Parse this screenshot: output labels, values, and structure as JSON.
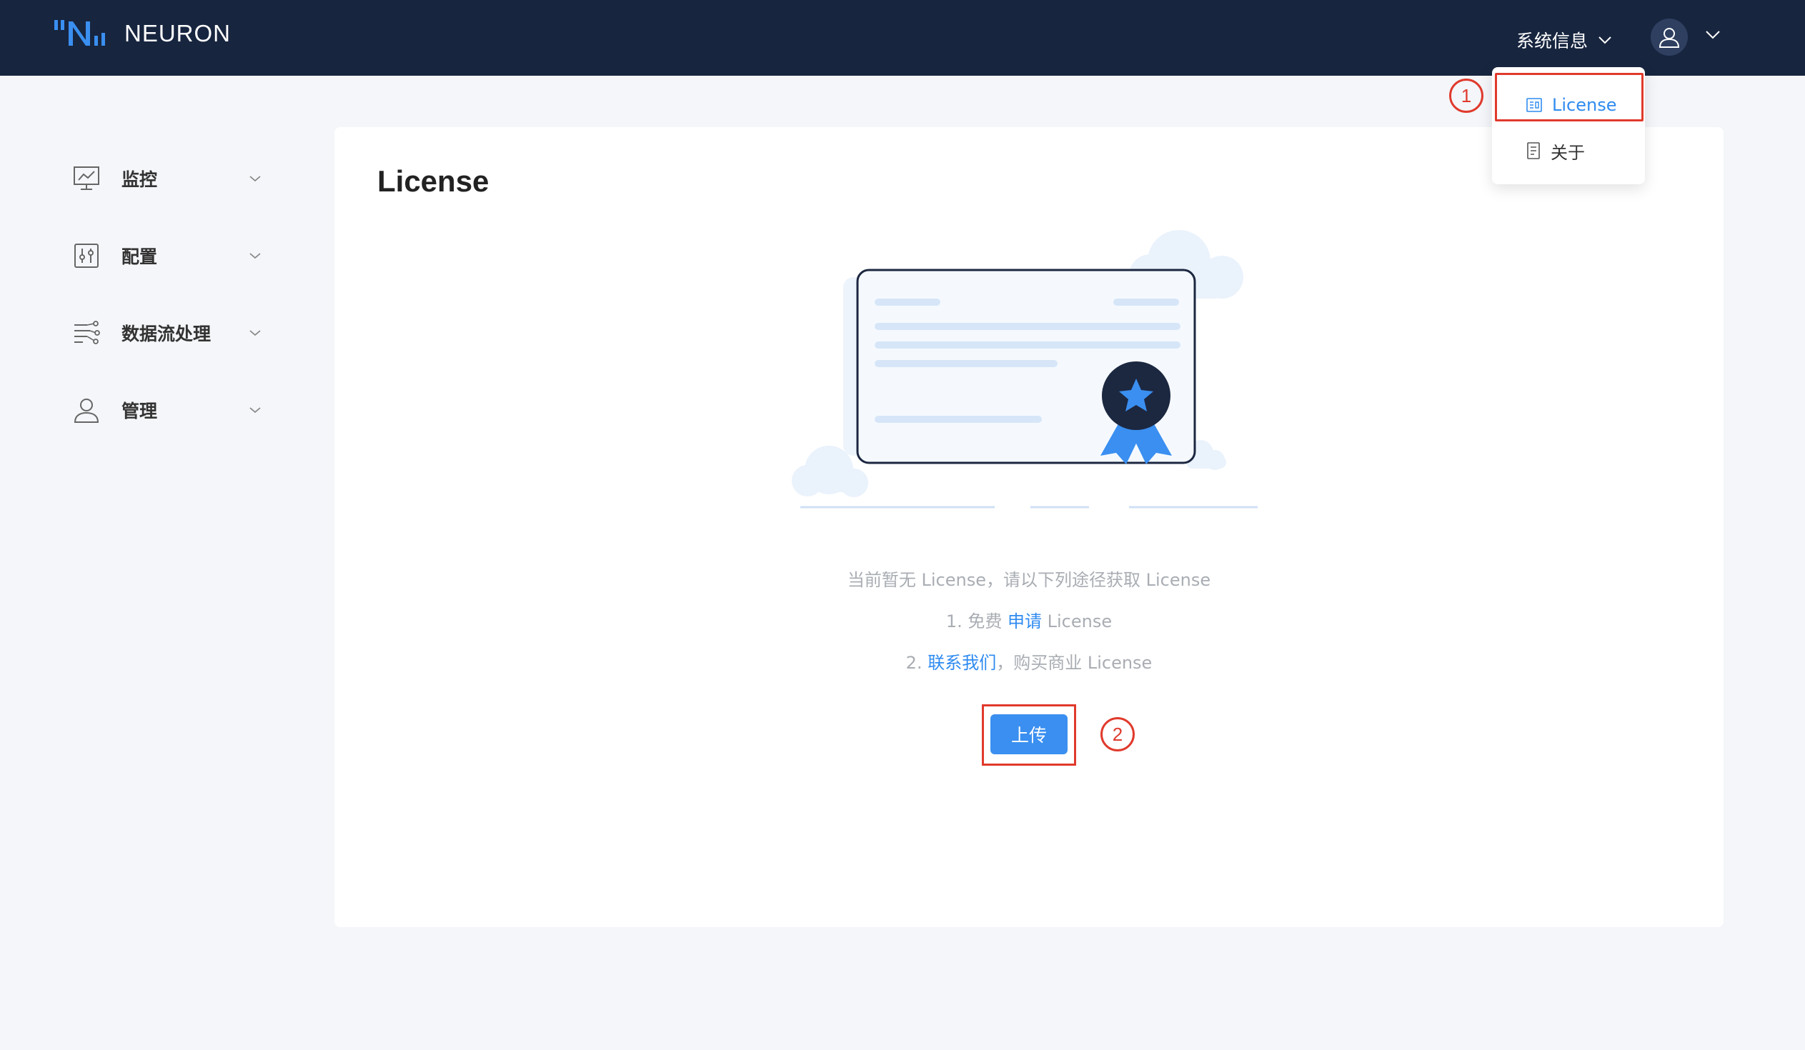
{
  "header": {
    "brand": "NEURON",
    "system_info_label": "系统信息",
    "icons": {
      "logo": "neuron-logo",
      "system_chevron": "chevron-down-icon",
      "avatar": "user-icon",
      "avatar_chevron": "chevron-down-icon"
    }
  },
  "dropdown": {
    "items": [
      {
        "label": "License",
        "icon": "license-icon",
        "active": true
      },
      {
        "label": "关于",
        "icon": "document-icon",
        "active": false
      }
    ]
  },
  "annotations": {
    "badge1": "1",
    "badge2": "2",
    "color": "#e03a2c"
  },
  "sidebar": {
    "items": [
      {
        "label": "监控",
        "icon": "monitor-chart-icon"
      },
      {
        "label": "配置",
        "icon": "config-sliders-icon"
      },
      {
        "label": "数据流处理",
        "icon": "dataflow-icon"
      },
      {
        "label": "管理",
        "icon": "user-manage-icon"
      }
    ]
  },
  "main": {
    "title": "License",
    "message_line1": "当前暂无 License，请以下列途径获取 License",
    "line2_prefix": "1. 免费 ",
    "line2_link": "申请",
    "line2_suffix": " License",
    "line3_prefix": "2. ",
    "line3_link": "联系我们",
    "line3_suffix": "，购买商业 License",
    "upload_label": "上传"
  },
  "colors": {
    "header_bg": "#17253f",
    "accent": "#2f8bf0",
    "button": "#3a8ff0",
    "page_bg": "#f4f6f9",
    "muted_text": "#a9adb3"
  }
}
